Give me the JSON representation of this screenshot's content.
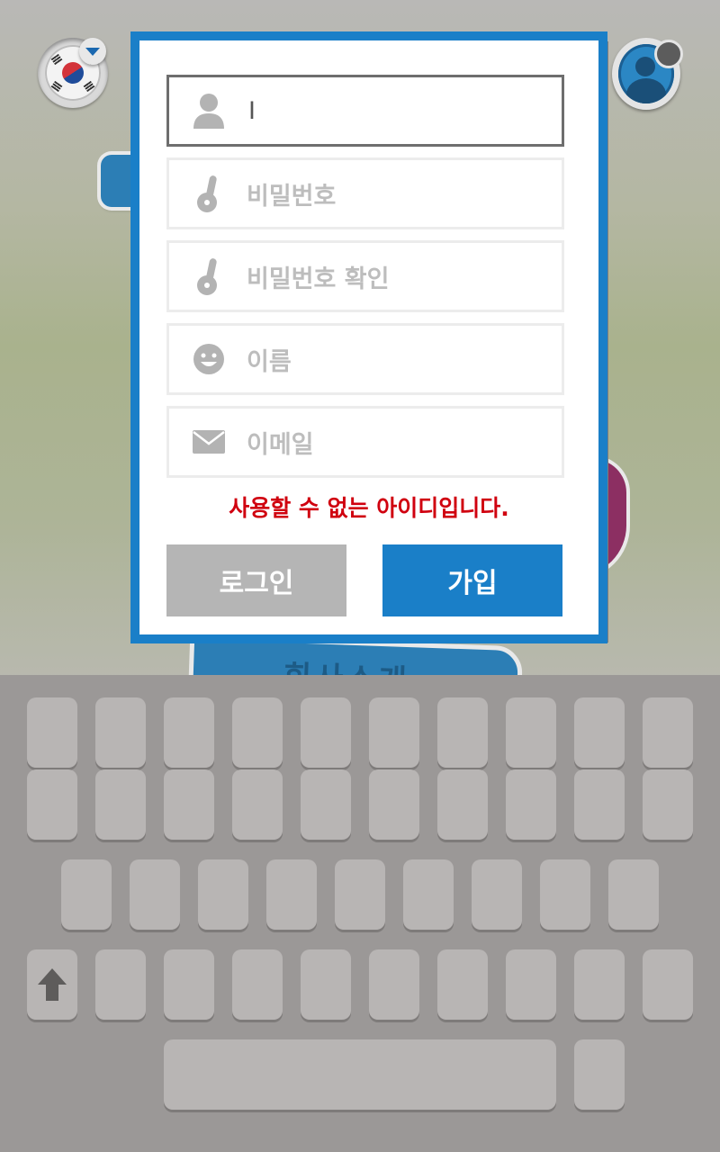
{
  "form": {
    "username_value": "I",
    "password_placeholder": "비밀번호",
    "password_confirm_placeholder": "비밀번호 확인",
    "name_placeholder": "이름",
    "email_placeholder": "이메일",
    "error_message": "사용할 수 없는 아이디입니다.",
    "login_label": "로그인",
    "join_label": "가입"
  },
  "background": {
    "sign_text": "회사소개"
  },
  "icons": {
    "language": "korean-flag-icon",
    "dropdown": "chevron-down-icon",
    "profile": "user-profile-icon",
    "username": "user-icon",
    "password": "key-icon",
    "name": "smiley-icon",
    "email": "envelope-icon",
    "shift": "shift-arrow-icon"
  },
  "colors": {
    "accent": "#1a7fc8",
    "error": "#d0000f",
    "secondary_button": "#b5b5b5",
    "keyboard_bg": "#9b9897",
    "key": "#b8b5b4"
  },
  "keyboard": {
    "rows": [
      10,
      10,
      9,
      10,
      2
    ]
  }
}
